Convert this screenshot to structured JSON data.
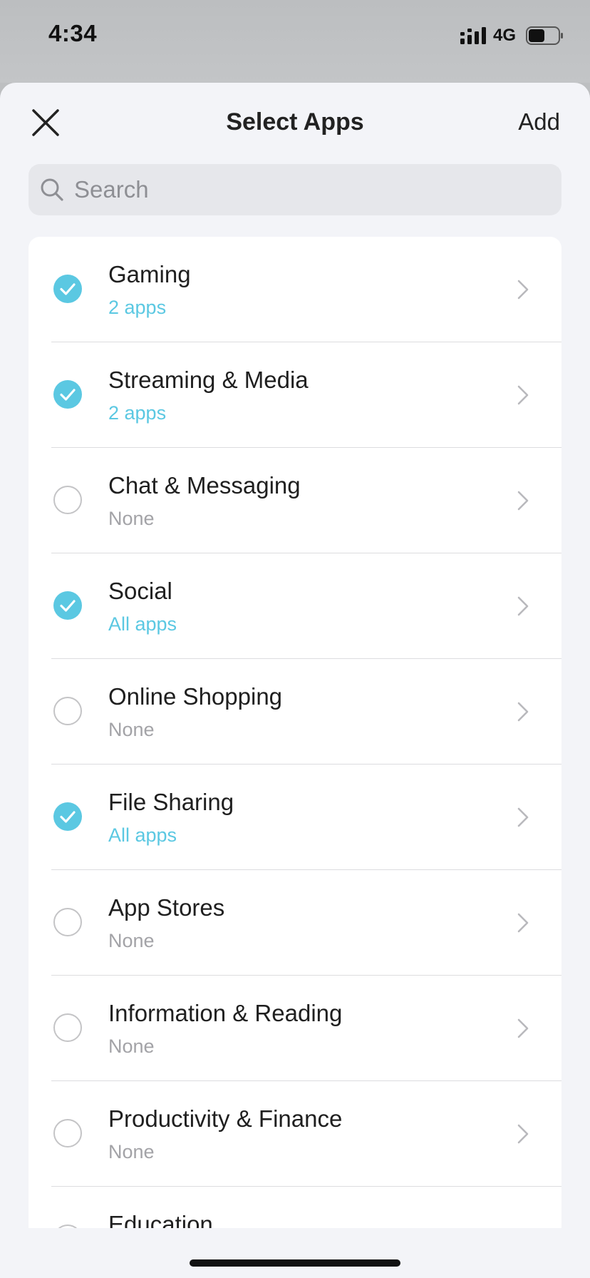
{
  "status_bar": {
    "time": "4:34",
    "network": "4G",
    "signal_icon": "cellular-signal-icon",
    "battery_icon": "battery-icon",
    "battery_level": 0.55
  },
  "header": {
    "title": "Select Apps",
    "close_icon": "close-icon",
    "add_label": "Add"
  },
  "search": {
    "placeholder": "Search",
    "value": "",
    "icon": "search-icon"
  },
  "categories": [
    {
      "name": "Gaming",
      "detail": "2 apps",
      "selected": true
    },
    {
      "name": "Streaming & Media",
      "detail": "2 apps",
      "selected": true
    },
    {
      "name": "Chat & Messaging",
      "detail": "None",
      "selected": false
    },
    {
      "name": "Social",
      "detail": "All apps",
      "selected": true
    },
    {
      "name": "Online Shopping",
      "detail": "None",
      "selected": false
    },
    {
      "name": "File Sharing",
      "detail": "All apps",
      "selected": true
    },
    {
      "name": "App Stores",
      "detail": "None",
      "selected": false
    },
    {
      "name": "Information & Reading",
      "detail": "None",
      "selected": false
    },
    {
      "name": "Productivity & Finance",
      "detail": "None",
      "selected": false
    },
    {
      "name": "Education",
      "detail": "",
      "selected": false
    }
  ],
  "colors": {
    "accent": "#5bc8e2",
    "muted": "#a3a3a7",
    "sheet_background": "#f3f4f8"
  }
}
